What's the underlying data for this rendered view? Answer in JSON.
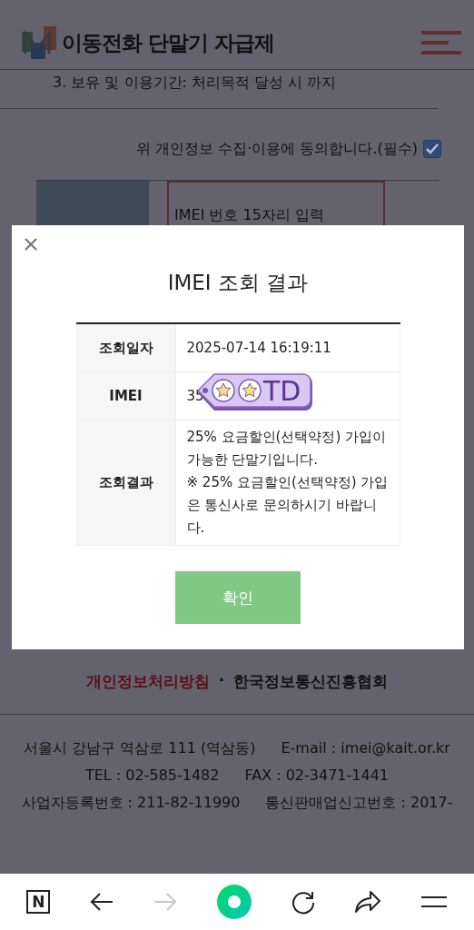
{
  "header": {
    "logo_text": "이동전화 단말기 자급제"
  },
  "notice": "3. 보유 및 이용기간: 처리목적 달성 시 까지",
  "consent": {
    "label": "위 개인정보 수집·이용에 동의합니다.(필수)",
    "checked": true
  },
  "imei_field": {
    "placeholder": "IMEI 번호 15자리 입력"
  },
  "modal": {
    "title": "IMEI 조회 결과",
    "rows": [
      {
        "label": "조회일자",
        "values": [
          "2025-07-14 16:19:11"
        ]
      },
      {
        "label": "IMEI",
        "values": [
          "35"
        ]
      },
      {
        "label": "조회결과",
        "values": [
          "25% 요금할인(선택약정) 가입이 가능한 단말기입니다.",
          "※ 25% 요금할인(선택약정) 가입은 통신사로 문의하시기 바랍니다."
        ]
      }
    ],
    "confirm_button": "확인"
  },
  "sticker": {
    "text": "TD"
  },
  "footer": {
    "links": [
      {
        "label": "개인정보처리방침",
        "kind": "privacy"
      },
      {
        "label": "한국정보통신진흥협회",
        "kind": "org"
      }
    ],
    "separator": "·",
    "info": [
      "서울시 강남구 역삼로 111 (역삼동)",
      "E-mail : imei@kait.or.kr",
      "TEL : 02-585-1482",
      "FAX : 02-3471-1441",
      "사업자등록번호 : 211-82-11990",
      "통신판매업신고번호 : 2017-"
    ]
  },
  "browser_bar": [
    {
      "kind": "naver",
      "label": "N",
      "disabled": false
    },
    {
      "kind": "back",
      "disabled": false
    },
    {
      "kind": "forward",
      "disabled": true
    },
    {
      "kind": "green",
      "disabled": false
    },
    {
      "kind": "reload",
      "disabled": false
    },
    {
      "kind": "share",
      "disabled": false
    },
    {
      "kind": "menu",
      "disabled": false
    }
  ]
}
